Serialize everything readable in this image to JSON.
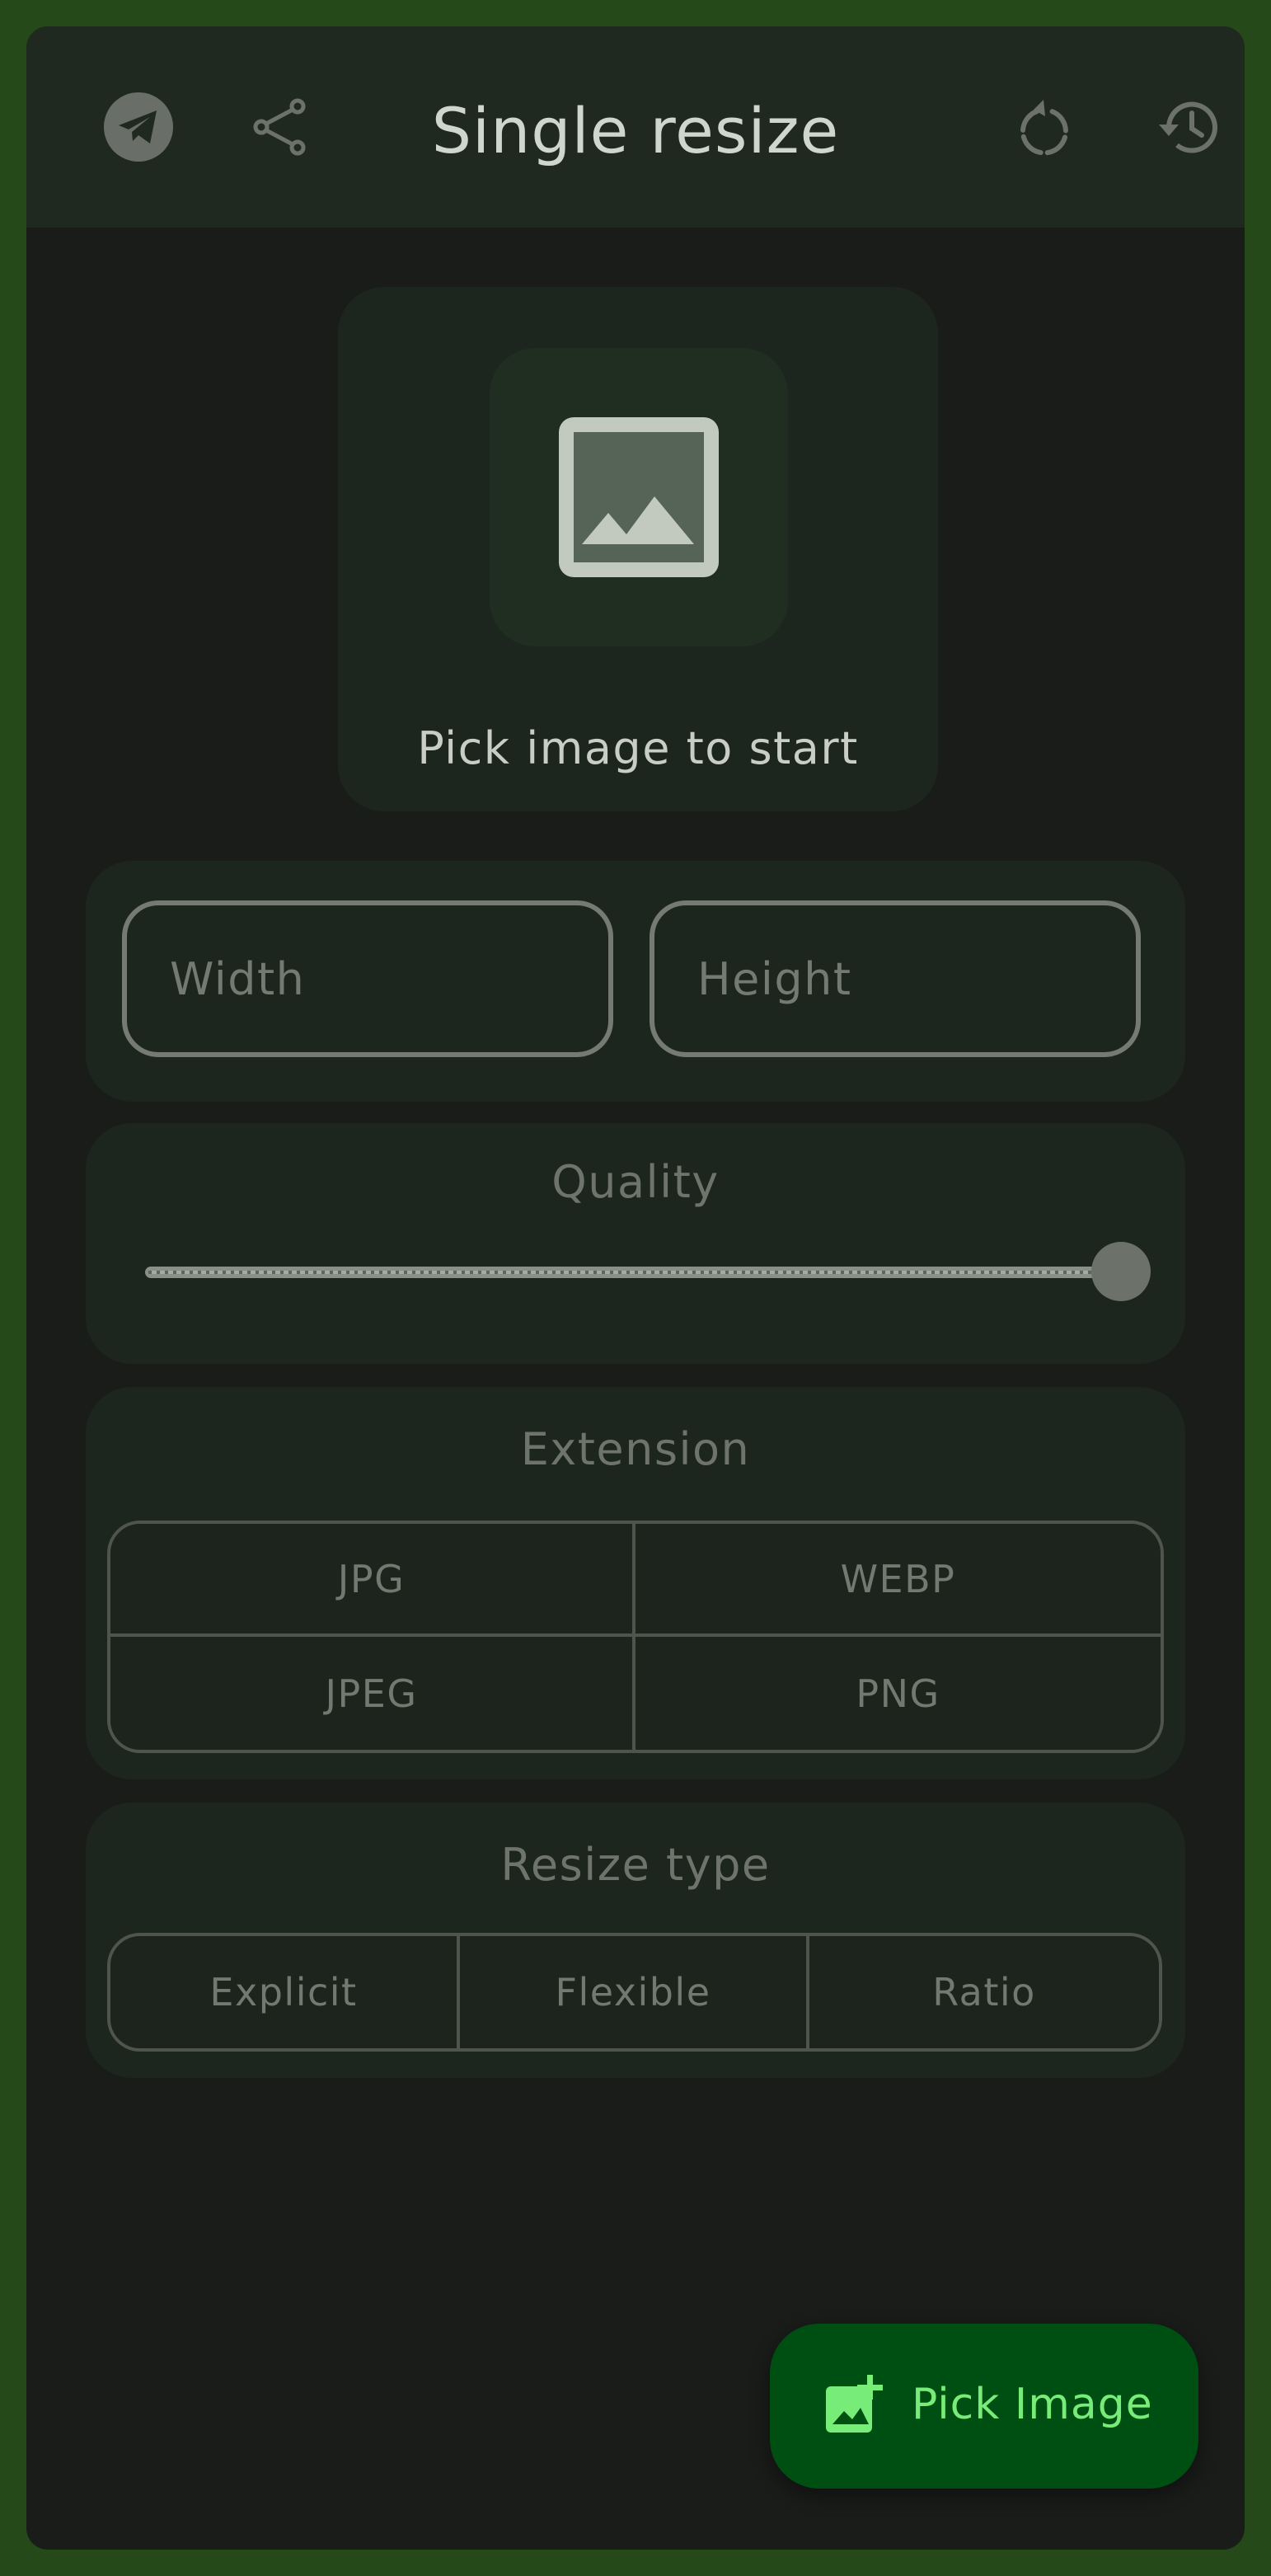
{
  "app": {
    "title": "Single resize"
  },
  "header": {
    "left_icons": [
      "telegram-icon",
      "share-icon"
    ],
    "right_icons": [
      "reset-icon",
      "history-icon"
    ]
  },
  "picker": {
    "icon": "image-icon",
    "text": "Pick image to start"
  },
  "dimensions": {
    "width_placeholder": "Width",
    "height_placeholder": "Height"
  },
  "quality": {
    "label": "Quality",
    "value_fraction": 1.0
  },
  "extension": {
    "label": "Extension",
    "options": [
      "JPG",
      "WEBP",
      "JPEG",
      "PNG"
    ]
  },
  "resize_type": {
    "label": "Resize type",
    "options": [
      "Explicit",
      "Flexible",
      "Ratio"
    ]
  },
  "fab": {
    "label": "Pick Image",
    "icon": "add-photo-icon"
  },
  "colors": {
    "frame": "#26491a",
    "background": "#1a1c1a",
    "surface": "#1d261e",
    "fab_background": "#004f12",
    "fab_accent": "#78ec78"
  }
}
